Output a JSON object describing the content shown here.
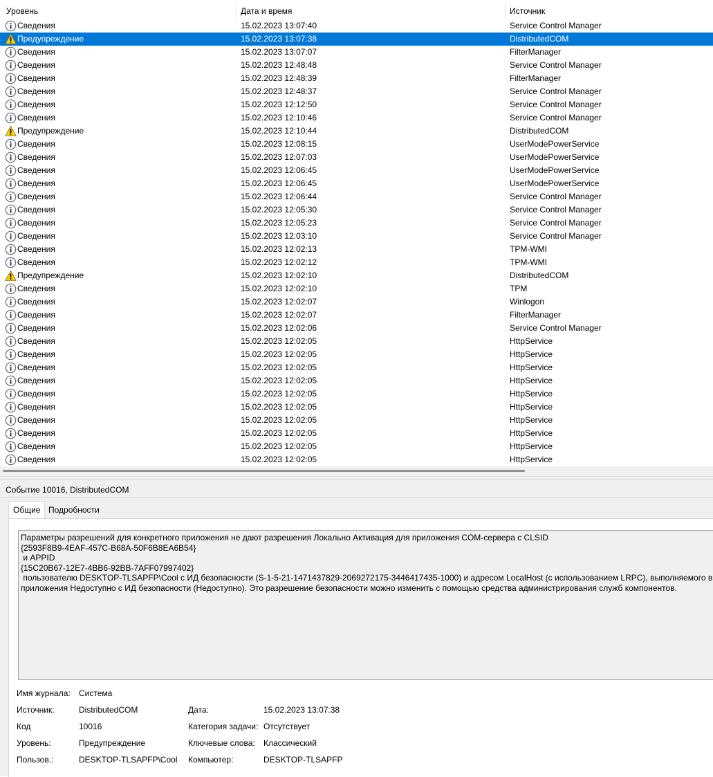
{
  "columns": {
    "level": "Уровень",
    "date": "Дата и время",
    "source": "Источник"
  },
  "events": [
    {
      "level": "Сведения",
      "type": "info",
      "date": "15.02.2023 13:07:40",
      "source": "Service Control Manager"
    },
    {
      "level": "Предупреждение",
      "type": "warning",
      "date": "15.02.2023 13:07:38",
      "source": "DistributedCOM",
      "selected": true
    },
    {
      "level": "Сведения",
      "type": "info",
      "date": "15.02.2023 13:07:07",
      "source": "FilterManager"
    },
    {
      "level": "Сведения",
      "type": "info",
      "date": "15.02.2023 12:48:48",
      "source": "Service Control Manager"
    },
    {
      "level": "Сведения",
      "type": "info",
      "date": "15.02.2023 12:48:39",
      "source": "FilterManager"
    },
    {
      "level": "Сведения",
      "type": "info",
      "date": "15.02.2023 12:48:37",
      "source": "Service Control Manager"
    },
    {
      "level": "Сведения",
      "type": "info",
      "date": "15.02.2023 12:12:50",
      "source": "Service Control Manager"
    },
    {
      "level": "Сведения",
      "type": "info",
      "date": "15.02.2023 12:10:46",
      "source": "Service Control Manager"
    },
    {
      "level": "Предупреждение",
      "type": "warning",
      "date": "15.02.2023 12:10:44",
      "source": "DistributedCOM"
    },
    {
      "level": "Сведения",
      "type": "info",
      "date": "15.02.2023 12:08:15",
      "source": "UserModePowerService"
    },
    {
      "level": "Сведения",
      "type": "info",
      "date": "15.02.2023 12:07:03",
      "source": "UserModePowerService"
    },
    {
      "level": "Сведения",
      "type": "info",
      "date": "15.02.2023 12:06:45",
      "source": "UserModePowerService"
    },
    {
      "level": "Сведения",
      "type": "info",
      "date": "15.02.2023 12:06:45",
      "source": "UserModePowerService"
    },
    {
      "level": "Сведения",
      "type": "info",
      "date": "15.02.2023 12:06:44",
      "source": "Service Control Manager"
    },
    {
      "level": "Сведения",
      "type": "info",
      "date": "15.02.2023 12:05:30",
      "source": "Service Control Manager"
    },
    {
      "level": "Сведения",
      "type": "info",
      "date": "15.02.2023 12:05:23",
      "source": "Service Control Manager"
    },
    {
      "level": "Сведения",
      "type": "info",
      "date": "15.02.2023 12:03:10",
      "source": "Service Control Manager"
    },
    {
      "level": "Сведения",
      "type": "info",
      "date": "15.02.2023 12:02:13",
      "source": "TPM-WMI"
    },
    {
      "level": "Сведения",
      "type": "info",
      "date": "15.02.2023 12:02:12",
      "source": "TPM-WMI"
    },
    {
      "level": "Предупреждение",
      "type": "warning",
      "date": "15.02.2023 12:02:10",
      "source": "DistributedCOM"
    },
    {
      "level": "Сведения",
      "type": "info",
      "date": "15.02.2023 12:02:10",
      "source": "TPM"
    },
    {
      "level": "Сведения",
      "type": "info",
      "date": "15.02.2023 12:02:07",
      "source": "Winlogon"
    },
    {
      "level": "Сведения",
      "type": "info",
      "date": "15.02.2023 12:02:07",
      "source": "FilterManager"
    },
    {
      "level": "Сведения",
      "type": "info",
      "date": "15.02.2023 12:02:06",
      "source": "Service Control Manager"
    },
    {
      "level": "Сведения",
      "type": "info",
      "date": "15.02.2023 12:02:05",
      "source": "HttpService"
    },
    {
      "level": "Сведения",
      "type": "info",
      "date": "15.02.2023 12:02:05",
      "source": "HttpService"
    },
    {
      "level": "Сведения",
      "type": "info",
      "date": "15.02.2023 12:02:05",
      "source": "HttpService"
    },
    {
      "level": "Сведения",
      "type": "info",
      "date": "15.02.2023 12:02:05",
      "source": "HttpService"
    },
    {
      "level": "Сведения",
      "type": "info",
      "date": "15.02.2023 12:02:05",
      "source": "HttpService"
    },
    {
      "level": "Сведения",
      "type": "info",
      "date": "15.02.2023 12:02:05",
      "source": "HttpService"
    },
    {
      "level": "Сведения",
      "type": "info",
      "date": "15.02.2023 12:02:05",
      "source": "HttpService"
    },
    {
      "level": "Сведения",
      "type": "info",
      "date": "15.02.2023 12:02:05",
      "source": "HttpService"
    },
    {
      "level": "Сведения",
      "type": "info",
      "date": "15.02.2023 12:02:05",
      "source": "HttpService"
    },
    {
      "level": "Сведения",
      "type": "info",
      "date": "15.02.2023 12:02:05",
      "source": "HttpService"
    }
  ],
  "icons": {
    "info": "info-circle-icon",
    "warning": "warning-triangle-icon"
  },
  "colors": {
    "selection": "#0078d7",
    "warning_fill": "#fcd116",
    "pane_background": "#f0f0f0"
  },
  "details": {
    "title": "Событие 10016, DistributedCOM",
    "tabs": [
      "Общие",
      "Подробности"
    ],
    "active_tab": "Общие",
    "message": "Параметры разрешений для конкретного приложения не дают разрешения Локально Активация для приложения COM-сервера с CLSID\n{2593F8B9-4EAF-457C-B68A-50F6B8EA6B54}\n и APPID\n{15C20B67-12E7-4BB6-92BB-7AFF07997402}\n пользователю DESKTOP-TLSAPFP\\Cool с ИД безопасности (S-1-5-21-1471437829-2069272175-3446417435-1000) и адресом LocalHost (с использованием LRPC), выполняемого в контейнере\nприложения Недоступно с ИД безопасности (Недоступно). Это разрешение безопасности можно изменить с помощью средства администрирования служб компонентов.",
    "props": {
      "log_name_label": "Имя журнала:",
      "log_name": "Система",
      "source_label": "Источник:",
      "source": "DistributedCOM",
      "code_label": "Код",
      "code": "10016",
      "level_label": "Уровень:",
      "level": "Предупреждение",
      "user_label": "Пользов.:",
      "user": "DESKTOP-TLSAPFP\\Cool",
      "date_label": "Дата:",
      "date": "15.02.2023 13:07:38",
      "task_label": "Категория задачи:",
      "task": "Отсутствует",
      "keywords_label": "Ключевые слова:",
      "keywords": "Классический",
      "computer_label": "Компьютер:",
      "computer": "DESKTOP-TLSAPFP"
    }
  }
}
